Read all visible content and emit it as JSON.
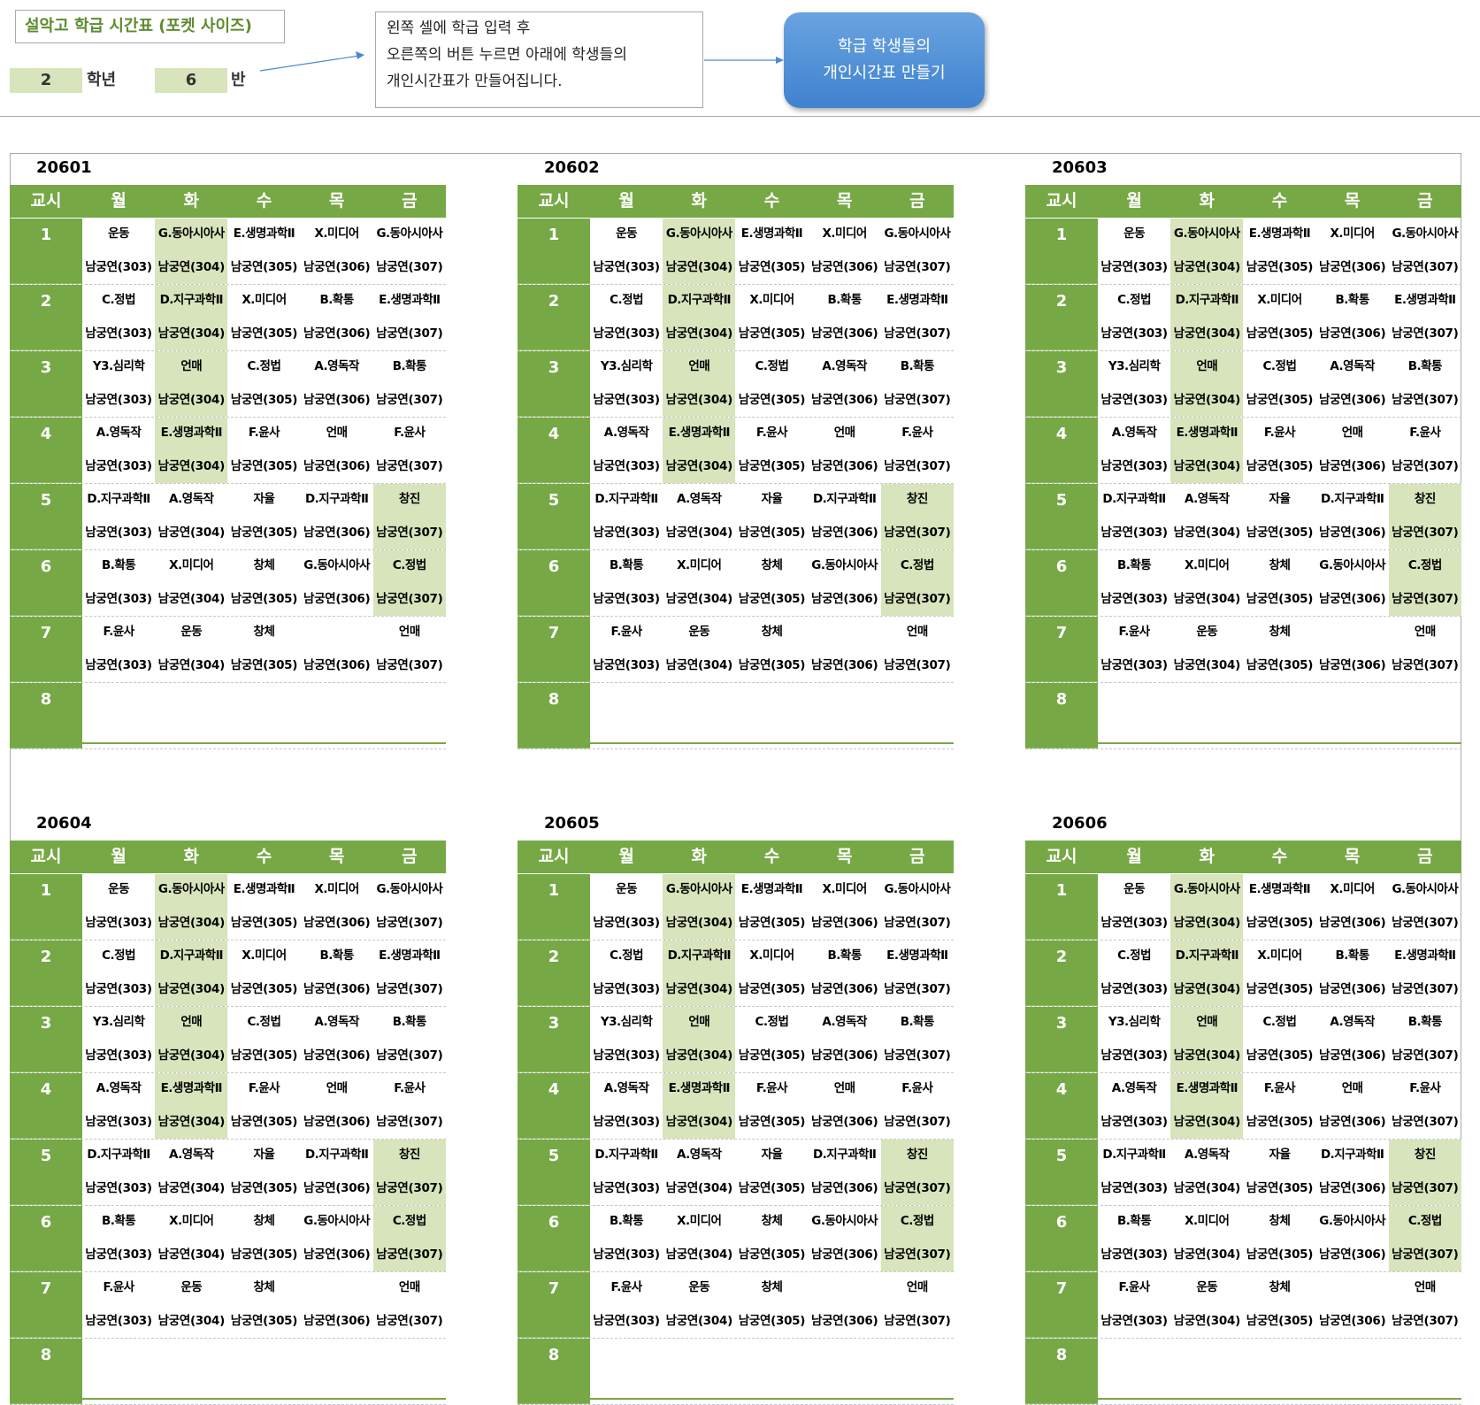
{
  "header": {
    "title": "설악고 학급 시간표 (포켓 사이즈)",
    "grade_value": "2",
    "grade_label": "학년",
    "class_value": "6",
    "class_label": "반",
    "note_lines": [
      "왼쪽 셀에 학급 입력 후",
      "오른쪽의 버튼 누르면 아래에 학생들의",
      "개인시간표가 만들어집니다."
    ],
    "button_lines": [
      "학급 학생들의",
      "개인시간표 만들기"
    ]
  },
  "colors": {
    "accent": "#76a845",
    "highlight": "#d8e4bc",
    "button": "#4a8ad4"
  },
  "timetable": {
    "columns": [
      "교시",
      "월",
      "화",
      "수",
      "목",
      "금"
    ],
    "periods": [
      {
        "no": "1",
        "subjects": [
          "운동",
          "G.동아시아사",
          "E.생명과학Ⅱ",
          "X.미디어",
          "G.동아시아사"
        ]
      },
      {
        "no": "2",
        "subjects": [
          "C.정법",
          "D.지구과학Ⅱ",
          "X.미디어",
          "B.확통",
          "E.생명과학Ⅱ"
        ]
      },
      {
        "no": "3",
        "subjects": [
          "Y3.심리학",
          "언매",
          "C.정법",
          "A.영독작",
          "B.확통"
        ]
      },
      {
        "no": "4",
        "subjects": [
          "A.영독작",
          "E.생명과학Ⅱ",
          "F.윤사",
          "언매",
          "F.윤사"
        ]
      },
      {
        "no": "5",
        "subjects": [
          "D.지구과학Ⅱ",
          "A.영독작",
          "자율",
          "D.지구과학Ⅱ",
          "창진"
        ]
      },
      {
        "no": "6",
        "subjects": [
          "B.확통",
          "X.미디어",
          "창체",
          "G.동아시아사",
          "C.정법"
        ]
      },
      {
        "no": "7",
        "subjects": [
          "F.윤사",
          "운동",
          "창체",
          "",
          "언매"
        ]
      },
      {
        "no": "8",
        "subjects": [
          "",
          "",
          "",
          "",
          ""
        ]
      }
    ],
    "rooms": [
      "남궁연(303)",
      "남궁연(304)",
      "남궁연(305)",
      "남궁연(306)",
      "남궁연(307)"
    ]
  },
  "students": [
    "20601",
    "20602",
    "20603",
    "20604",
    "20605",
    "20606"
  ]
}
